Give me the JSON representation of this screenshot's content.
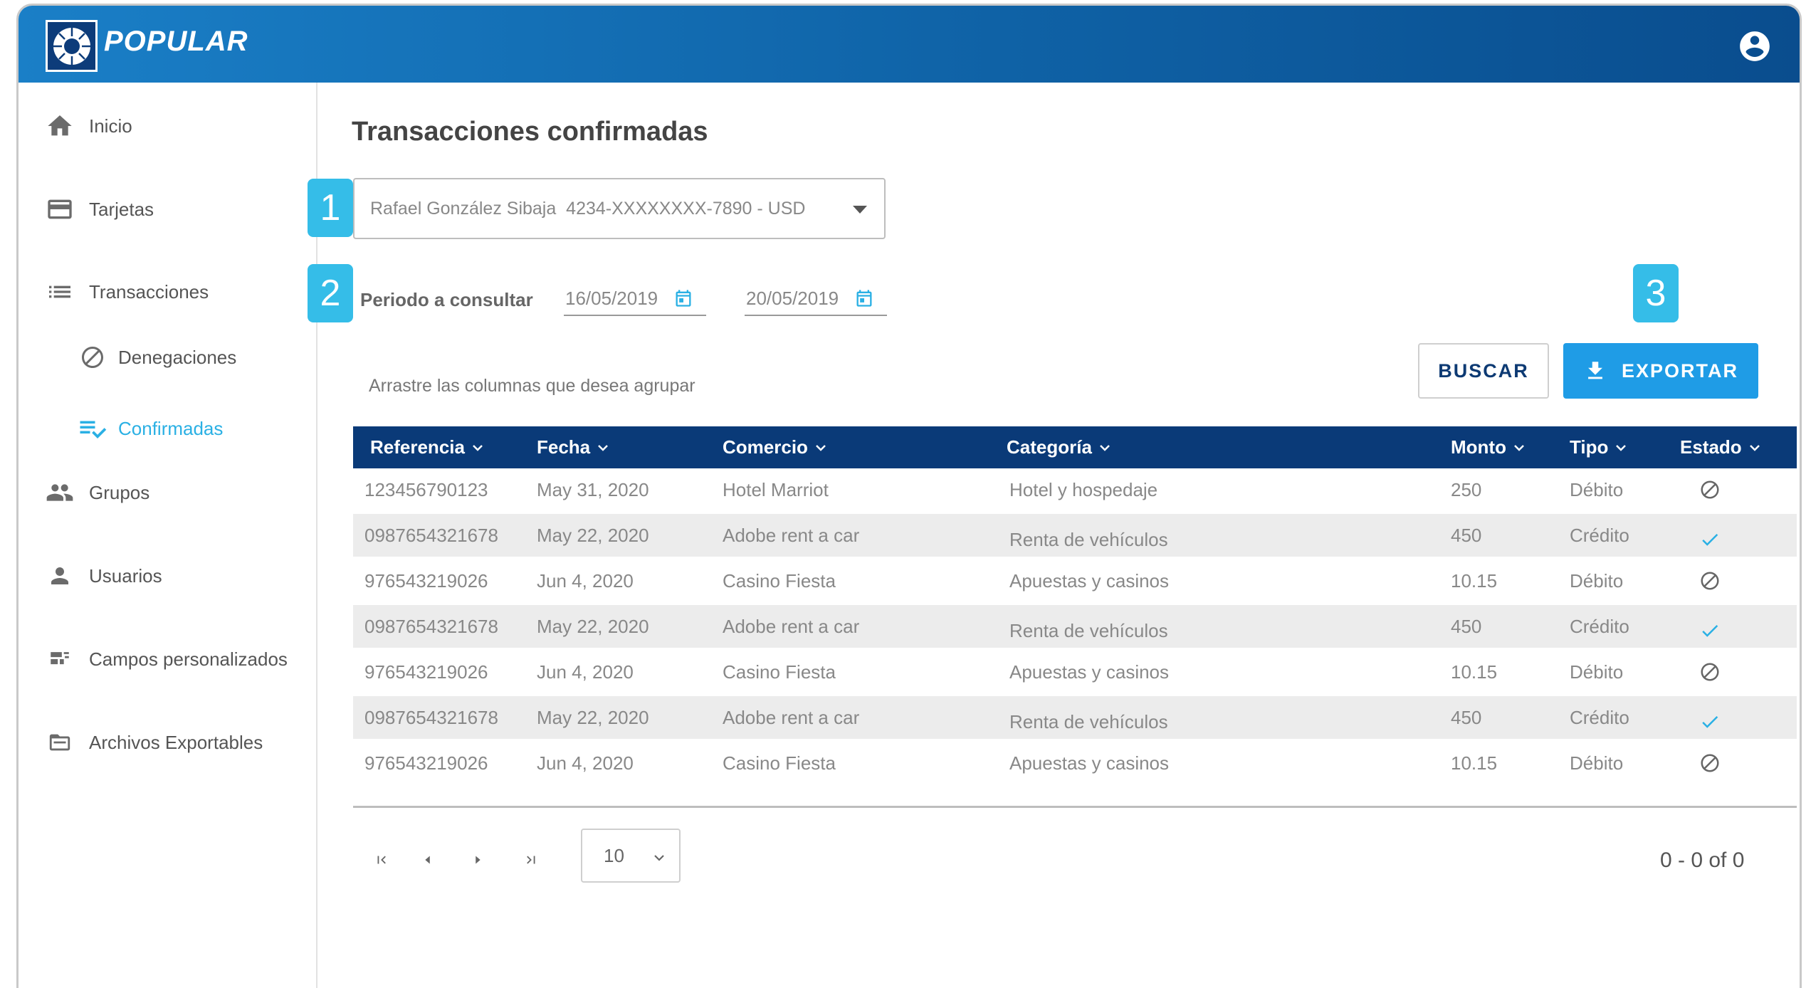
{
  "header": {
    "brand": "POPULAR",
    "brand_bg": "#0f62a6"
  },
  "sidebar": {
    "items": [
      {
        "label": "Inicio",
        "icon": "home-icon"
      },
      {
        "label": "Tarjetas",
        "icon": "credit-card-icon"
      },
      {
        "label": "Transacciones",
        "icon": "list-icon"
      },
      {
        "label": "Denegaciones",
        "icon": "block-icon"
      },
      {
        "label": "Confirmadas",
        "icon": "playlist-check-icon",
        "active": true
      },
      {
        "label": "Grupos",
        "icon": "group-icon"
      },
      {
        "label": "Usuarios",
        "icon": "person-icon"
      },
      {
        "label": "Campos personalizados",
        "icon": "custom-fields-icon"
      },
      {
        "label": "Archivos Exportables",
        "icon": "folder-icon"
      }
    ],
    "active_color": "#2ab0e4"
  },
  "main": {
    "title": "Transacciones confirmadas",
    "steps": [
      "1",
      "2",
      "3"
    ],
    "account": {
      "value": "Rafael González Sibaja  4234-XXXXXXXX-7890 - USD"
    },
    "period": {
      "label": "Periodo a consultar",
      "from": "16/05/2019",
      "to": "20/05/2019"
    },
    "drag_hint": "Arrastre las columnas que desea agrupar",
    "buttons": {
      "search": "BUSCAR",
      "export": "EXPORTAR"
    },
    "table": {
      "header_bg": "#0a3a78",
      "columns": [
        "Referencia",
        "Fecha",
        "Comercio",
        "Categoría",
        "Monto",
        "Tipo",
        "Estado"
      ],
      "rows": [
        {
          "ref": "123456790123",
          "date": "May 31, 2020",
          "merchant": "Hotel Marriot",
          "category": "Hotel y hospedaje",
          "amount": "250",
          "type": "Débito",
          "status": "block-icon"
        },
        {
          "ref": "0987654321678",
          "date": "May 22, 2020",
          "merchant": "Adobe rent a car",
          "category": "Renta de vehículos",
          "amount": "450",
          "type": "Crédito",
          "status": "check-icon"
        },
        {
          "ref": "976543219026",
          "date": "Jun 4, 2020",
          "merchant": "Casino Fiesta",
          "category": "Apuestas y casinos",
          "amount": "10.15",
          "type": "Débito",
          "status": "block-icon"
        },
        {
          "ref": "0987654321678",
          "date": "May 22, 2020",
          "merchant": "Adobe rent a car",
          "category": "Renta de vehículos",
          "amount": "450",
          "type": "Crédito",
          "status": "check-icon"
        },
        {
          "ref": "976543219026",
          "date": "Jun 4, 2020",
          "merchant": "Casino Fiesta",
          "category": "Apuestas y casinos",
          "amount": "10.15",
          "type": "Débito",
          "status": "block-icon"
        },
        {
          "ref": "0987654321678",
          "date": "May 22, 2020",
          "merchant": "Adobe rent a car",
          "category": "Renta de vehículos",
          "amount": "450",
          "type": "Crédito",
          "status": "check-icon"
        },
        {
          "ref": "976543219026",
          "date": "Jun 4, 2020",
          "merchant": "Casino Fiesta",
          "category": "Apuestas y casinos",
          "amount": "10.15",
          "type": "Débito",
          "status": "block-icon"
        }
      ]
    },
    "pagination": {
      "page_size": "10",
      "range": "0 - 0 of 0"
    }
  }
}
